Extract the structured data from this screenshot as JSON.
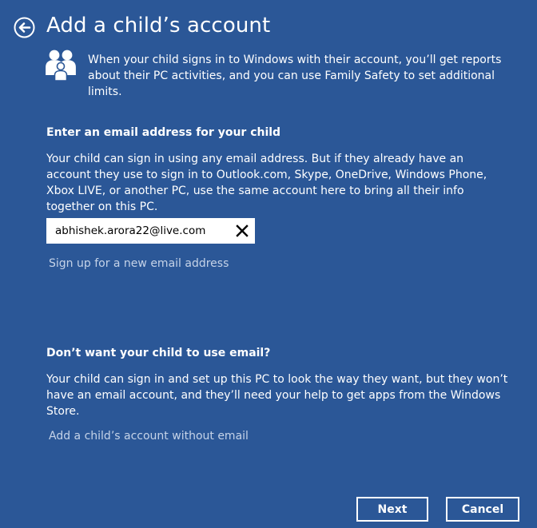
{
  "header": {
    "title": "Add a child’s account",
    "back_icon": "back-arrow-icon"
  },
  "intro": {
    "icon": "family-icon",
    "text": "When your child signs in to Windows with their account, you’ll get reports about their PC activities, and you can use Family Safety to set additional limits."
  },
  "email_section": {
    "heading": "Enter an email address for your child",
    "description": "Your child can sign in using any email address. But if they already have an account they use to sign in to Outlook.com, Skype, OneDrive, Windows Phone, Xbox LIVE, or another PC, use the same account here to bring all their info together on this PC.",
    "email_value": "abhishek.arora22@live.com",
    "clear_icon": "close-icon",
    "signup_link": "Sign up for a new email address"
  },
  "no_email_section": {
    "heading": "Don’t want your child to use email?",
    "description": "Your child can sign in and set up this PC to look the way they want, but they won’t have an email account, and they’ll need your help to get apps from the Windows Store.",
    "link": "Add a child’s account without email"
  },
  "footer": {
    "next_label": "Next",
    "cancel_label": "Cancel"
  },
  "colors": {
    "background": "#2b5797",
    "text": "#ffffff",
    "link": "#c5d3e8"
  }
}
